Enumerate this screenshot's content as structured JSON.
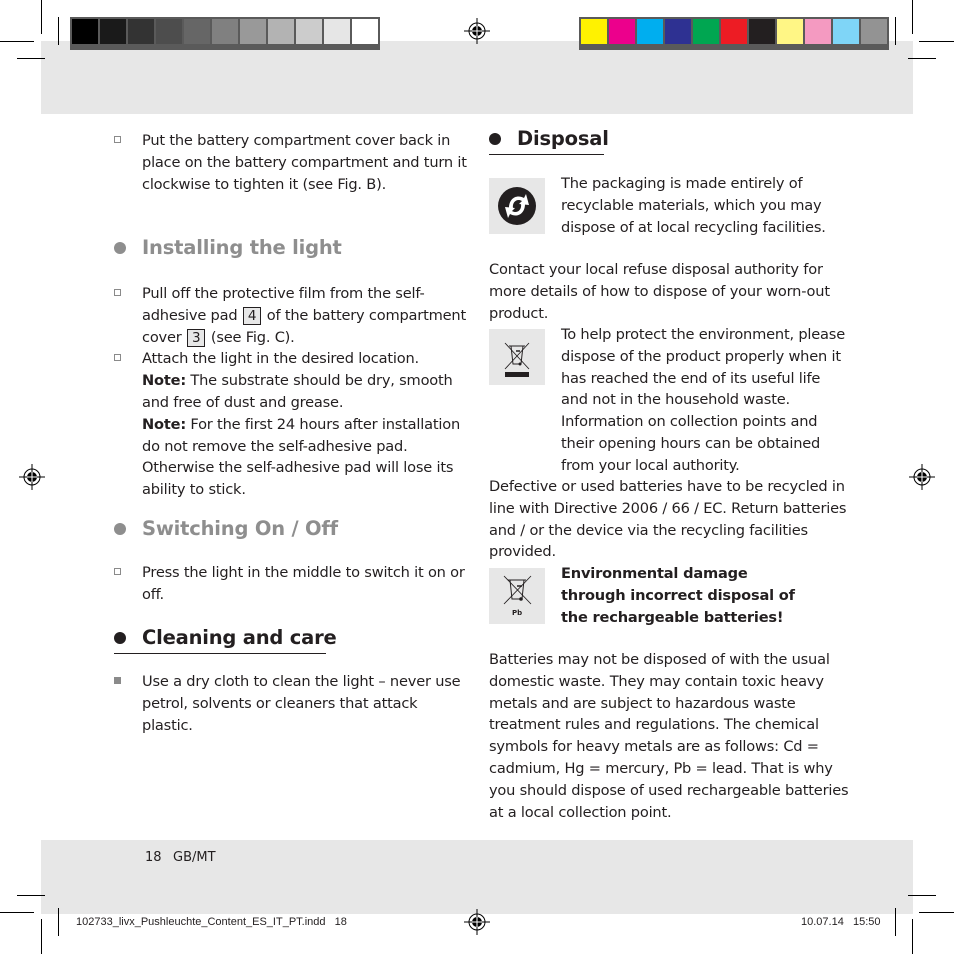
{
  "print_marks": {
    "grey_swatches": [
      "#000000",
      "#1a1a1a",
      "#333333",
      "#4d4d4d",
      "#666666",
      "#808080",
      "#999999",
      "#b3b3b3",
      "#cccccc",
      "#e6e6e6",
      "#ffffff"
    ],
    "color_swatches": [
      "#fff200",
      "#ec008c",
      "#00aeef",
      "#2e3192",
      "#00a651",
      "#ed1c24",
      "#231f20",
      "#fff685",
      "#f49ac1",
      "#7fd5f7",
      "#939393"
    ]
  },
  "left_column": {
    "intro_item": "Put the battery compartment cover back in place on the battery compartment and turn it clockwise to tighten it (see Fig. B).",
    "installing": {
      "title": "Installing the light",
      "item1_part1": "Pull off the protective film from the self-adhesive pad",
      "item1_ref1": "4",
      "item1_part2": "of the battery compartment cover",
      "item1_ref2": "3",
      "item1_part3": "(see Fig. C).",
      "item2_text": "Attach the light in the desired location.",
      "note_label": "Note:",
      "note1": "The substrate should be dry, smooth and free of dust and grease.",
      "note2": "For the first 24 hours after installation do not remove the self-adhesive pad. Otherwise the self-adhesive pad will lose its ability to stick."
    },
    "switching": {
      "title": "Switching On / Off",
      "item": "Press the light in the middle to switch it on or off."
    },
    "cleaning": {
      "title": "Cleaning and care",
      "item": "Use a dry cloth to clean the light – never use petrol, solvents or cleaners that attack plastic."
    }
  },
  "right_column": {
    "disposal_title": "Disposal",
    "packaging_text": "The packaging is made entirely of recyclable materials, which you may dispose of at local recycling facilities.",
    "contact_text": "Contact your local refuse disposal authority for more details of how to dispose of your worn-out product.",
    "weee_text": "To help protect the environment, please dispose of the product properly when it has reached the end of its useful life and not in the household waste. Information on collection points and their opening hours can be obtained from your local authority.",
    "battery_directive_text": "Defective or used batteries have to be recycled in line with Directive 2006 / 66 / EC. Return batteries and / or the device via the recycling facilities provided.",
    "warning_title": "Environmental damage through incorrect disposal of the rechargeable batteries!",
    "pb_label": "Pb",
    "batteries_text": "Batteries may not be disposed of with the usual domestic waste. They may contain toxic heavy metals and are subject to hazardous waste treatment rules and regulations. The chemical symbols for heavy metals are as follows: Cd = cadmium, Hg = mercury, Pb = lead. That is why you should dispose of used rechargeable batteries at a local collection point."
  },
  "footer": {
    "page_number": "18",
    "locale": "GB/MT",
    "slug_file": "102733_livx_Pushleuchte_Content_ES_IT_PT.indd   18",
    "slug_date": "10.07.14   15:50"
  }
}
